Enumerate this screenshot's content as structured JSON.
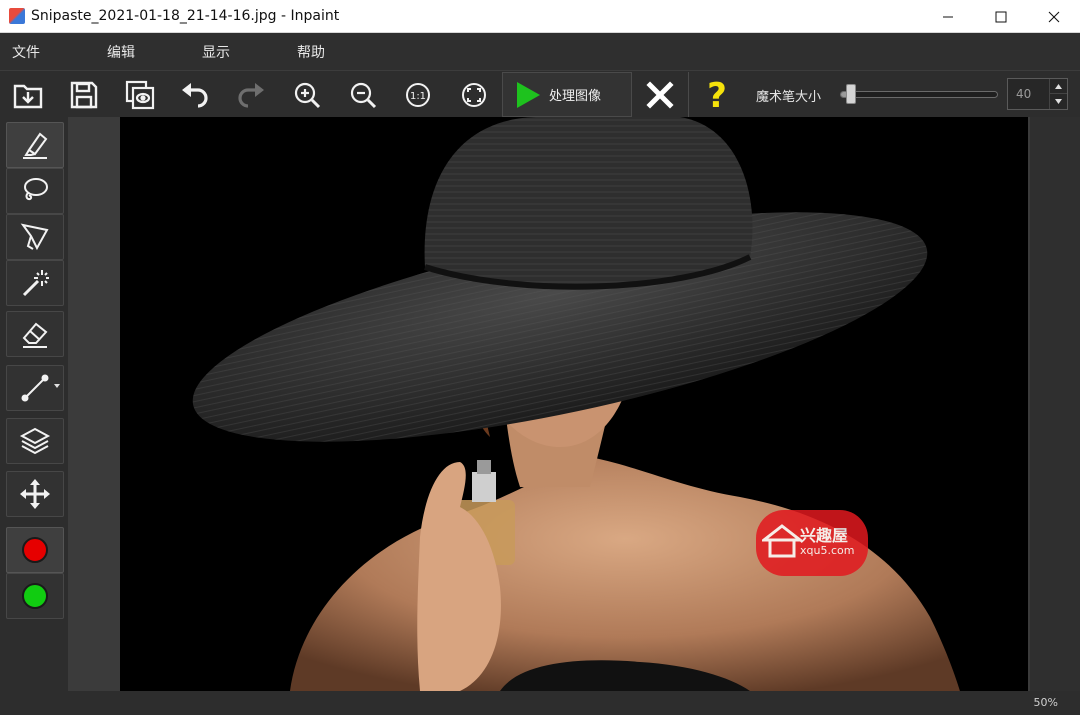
{
  "window": {
    "title": "Snipaste_2021-01-18_21-14-16.jpg - Inpaint",
    "controls": [
      "minimize-icon",
      "maximize-icon",
      "close-icon"
    ]
  },
  "menu": {
    "items": [
      {
        "label": "文件"
      },
      {
        "label": "编辑"
      },
      {
        "label": "显示"
      },
      {
        "label": "帮助"
      }
    ]
  },
  "toolbar": {
    "icons": [
      "open-folder-icon",
      "save-icon",
      "preview-icon",
      "undo-icon",
      "redo-icon",
      "zoom-in-icon",
      "zoom-out-icon",
      "actual-size-icon",
      "fit-screen-icon"
    ],
    "process_label": "处理图像",
    "cancel_icon": "x-icon",
    "help_icon": "question-icon",
    "brush_size_label": "魔术笔大小",
    "brush_size_value": "40",
    "brush_size_fraction": 0.04,
    "colors": {
      "play": "#1ec21e",
      "help": "#f5e20b",
      "cancel": "#ffffff"
    }
  },
  "tools": {
    "items": [
      "marker-icon",
      "lasso-icon",
      "polygon-lasso-icon",
      "magic-wand-icon",
      "eraser-icon",
      "line-icon",
      "layers-icon",
      "move-icon"
    ],
    "active": "marker-icon",
    "swatch_colors": [
      "#e60000",
      "#11cc11"
    ]
  },
  "watermark": {
    "title": "兴趣屋",
    "url": "xqu5.com"
  },
  "status": {
    "zoom": "50%"
  }
}
